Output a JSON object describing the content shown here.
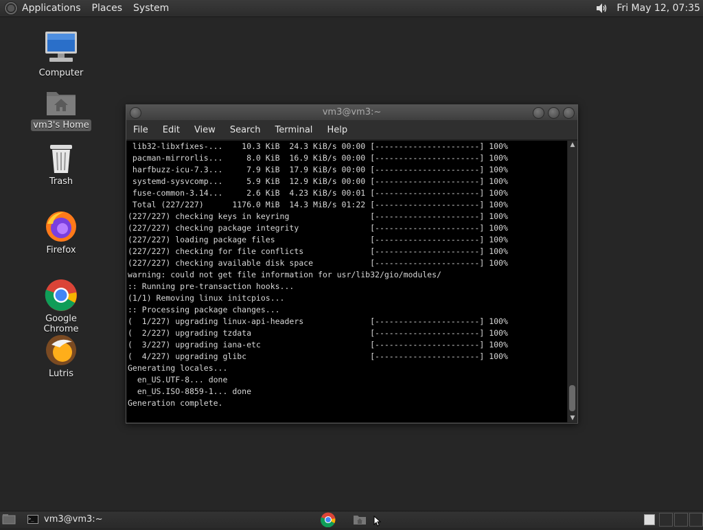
{
  "top_panel": {
    "menus": [
      "Applications",
      "Places",
      "System"
    ],
    "clock": "Fri May 12, 07:35",
    "volume_icon": "speaker-icon"
  },
  "desktop": {
    "icons": [
      {
        "label": "Computer",
        "icon": "computer-icon"
      },
      {
        "label": "vm3's Home",
        "icon": "home-folder-icon",
        "selected": true
      },
      {
        "label": "Trash",
        "icon": "trash-icon"
      },
      {
        "label": "Firefox",
        "icon": "firefox-icon"
      },
      {
        "label": "Google Chrome",
        "icon": "chrome-icon"
      },
      {
        "label": "Lutris",
        "icon": "lutris-icon"
      }
    ]
  },
  "terminal": {
    "title": "vm3@vm3:~",
    "menu": [
      "File",
      "Edit",
      "View",
      "Search",
      "Terminal",
      "Help"
    ],
    "lines": [
      " lib32-libxfixes-...    10.3 KiB  24.3 KiB/s 00:00 [----------------------] 100%",
      " pacman-mirrorlis...     8.0 KiB  16.9 KiB/s 00:00 [----------------------] 100%",
      " harfbuzz-icu-7.3...     7.9 KiB  17.9 KiB/s 00:00 [----------------------] 100%",
      " systemd-sysvcomp...     5.9 KiB  12.9 KiB/s 00:00 [----------------------] 100%",
      " fuse-common-3.14...     2.6 KiB  4.23 KiB/s 00:01 [----------------------] 100%",
      " Total (227/227)      1176.0 MiB  14.3 MiB/s 01:22 [----------------------] 100%",
      "(227/227) checking keys in keyring                 [----------------------] 100%",
      "(227/227) checking package integrity               [----------------------] 100%",
      "(227/227) loading package files                    [----------------------] 100%",
      "(227/227) checking for file conflicts              [----------------------] 100%",
      "(227/227) checking available disk space            [----------------------] 100%",
      "warning: could not get file information for usr/lib32/gio/modules/",
      ":: Running pre-transaction hooks...",
      "(1/1) Removing linux initcpios...",
      ":: Processing package changes...",
      "(  1/227) upgrading linux-api-headers              [----------------------] 100%",
      "(  2/227) upgrading tzdata                         [----------------------] 100%",
      "(  3/227) upgrading iana-etc                       [----------------------] 100%",
      "(  4/227) upgrading glibc                          [----------------------] 100%",
      "Generating locales...",
      "  en_US.UTF-8... done",
      "  en_US.ISO-8859-1... done",
      "Generation complete."
    ]
  },
  "taskbar": {
    "window_button_label": "vm3@vm3:~"
  }
}
